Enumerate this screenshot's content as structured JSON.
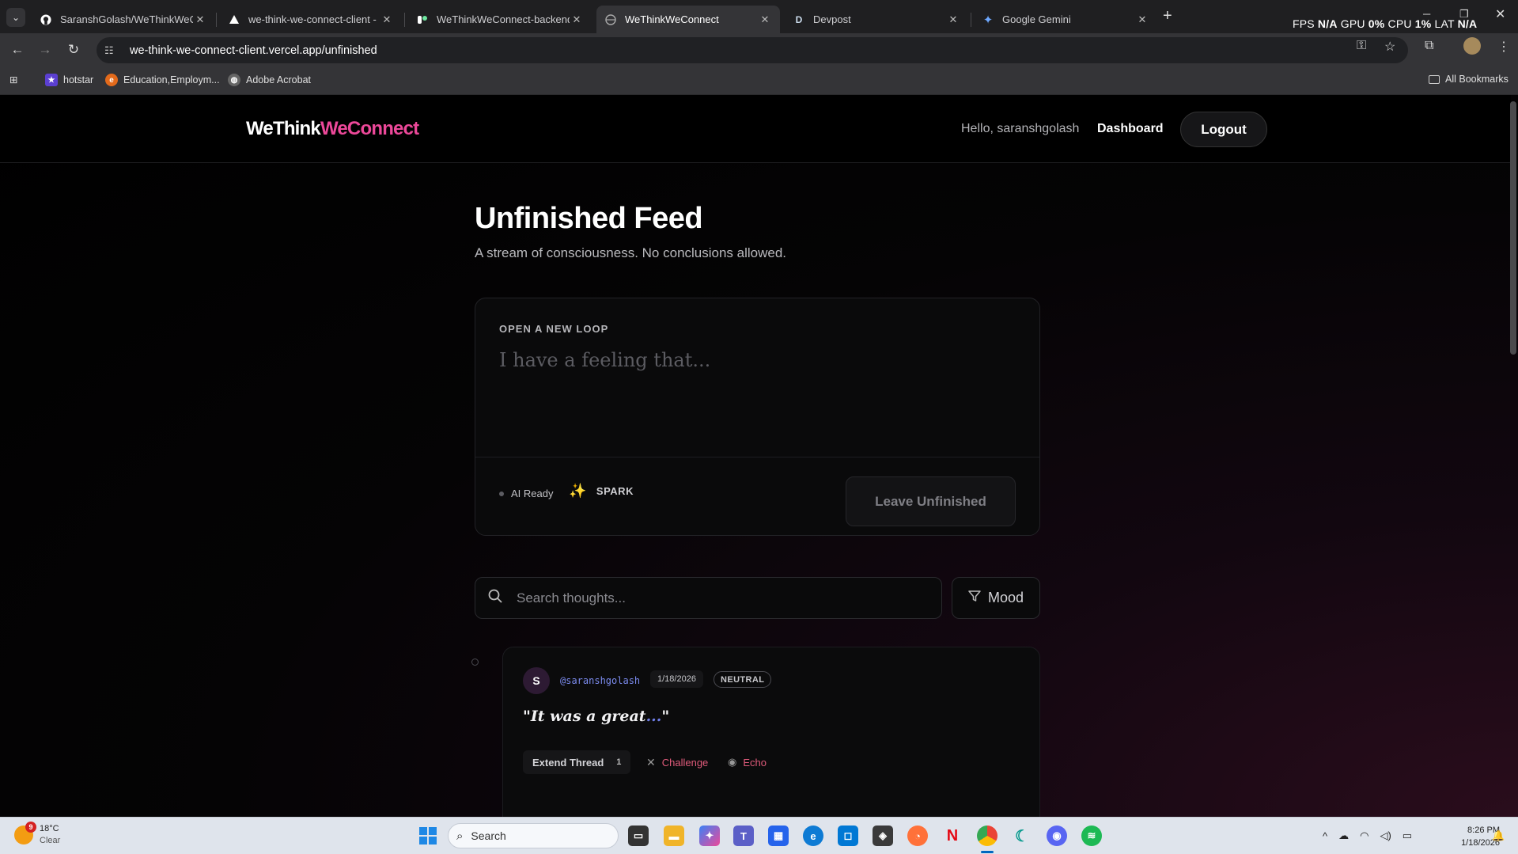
{
  "browser": {
    "tabs": [
      {
        "title": "SaranshGolash/WeThinkWeCon",
        "icon": "github-icon"
      },
      {
        "title": "we-think-we-connect-client - O",
        "icon": "vercel-icon"
      },
      {
        "title": "WeThinkWeConnect-backend -",
        "icon": "render-icon"
      },
      {
        "title": "WeThinkWeConnect",
        "icon": "globe-icon",
        "active": true
      },
      {
        "title": "Devpost",
        "icon": "devpost-icon"
      },
      {
        "title": "Google Gemini",
        "icon": "gemini-icon"
      }
    ],
    "perf": {
      "fps_label": "FPS",
      "fps": "N/A",
      "gpu_label": "GPU",
      "gpu": "0%",
      "cpu_label": "CPU",
      "cpu": "1%",
      "lat_label": "LAT",
      "lat": "N/A"
    },
    "url": "we-think-we-connect-client.vercel.app/unfinished",
    "bookmarks": [
      {
        "label": "hotstar",
        "color": "#5b3fd1"
      },
      {
        "label": "Education,Employm...",
        "color": "#e36a1b"
      },
      {
        "label": "Adobe Acrobat",
        "color": "#666666"
      }
    ],
    "all_bookmarks": "All Bookmarks"
  },
  "site": {
    "logo_part1": "WeThink",
    "logo_part2": "WeConnect",
    "hello": "Hello, saranshgolash",
    "dashboard": "Dashboard",
    "logout": "Logout"
  },
  "feed": {
    "title": "Unfinished Feed",
    "subtitle": "A stream of consciousness. No conclusions allowed.",
    "composer": {
      "label": "OPEN A NEW LOOP",
      "placeholder": "I have a feeling that...",
      "ai_status": "AI Ready",
      "spark": "SPARK",
      "submit": "Leave Unfinished"
    },
    "search_placeholder": "Search thoughts...",
    "mood_filter": "Mood",
    "posts": [
      {
        "avatar_letter": "S",
        "handle": "@saranshgolash",
        "date": "1/18/2026",
        "mood": "NEUTRAL",
        "quote_open": "\"It was a great",
        "quote_ellipsis": "...",
        "quote_close": "\"",
        "extend": "Extend Thread",
        "extend_count": "1",
        "challenge": "Challenge",
        "echo": "Echo"
      }
    ]
  },
  "taskbar": {
    "weather_temp": "18°C",
    "weather_cond": "Clear",
    "weather_badge": "9",
    "search": "Search",
    "time": "8:26 PM",
    "date": "1/18/2026"
  },
  "colors": {
    "accent_pink": "#ec4899",
    "handle_blue": "#7c8cf0",
    "action_red": "#e05b7b"
  }
}
